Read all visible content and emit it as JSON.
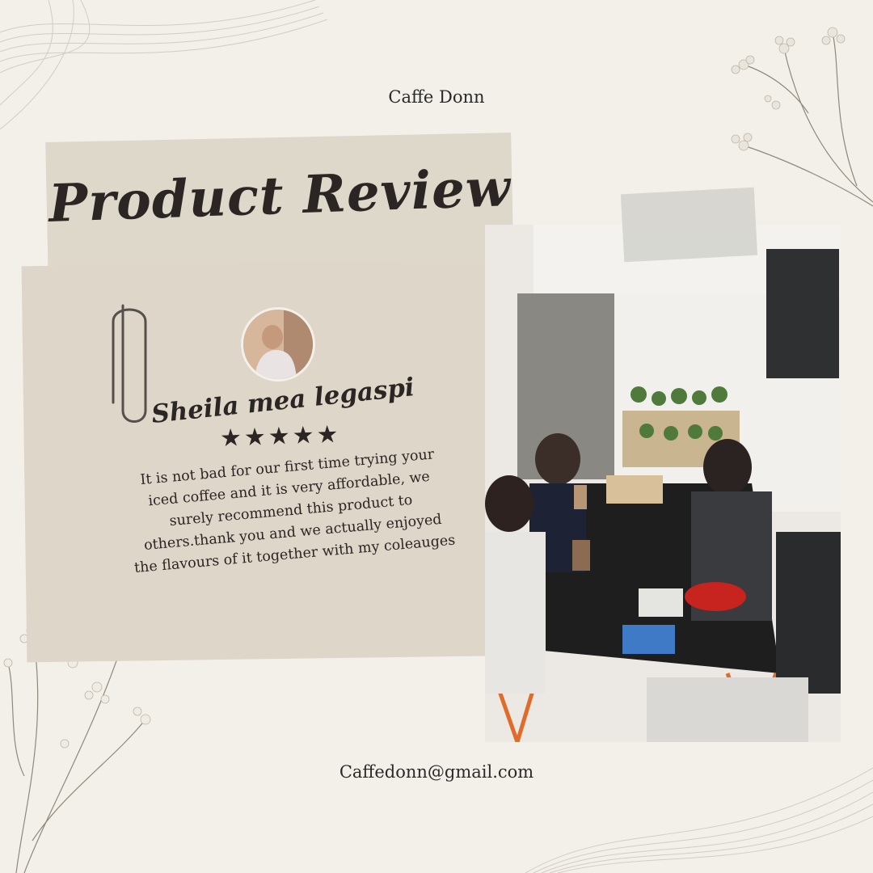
{
  "brand": "Caffe Donn",
  "title": "Product Review",
  "reviewer_name": "Sheila mea legaspi",
  "rating": 5,
  "stars": "★★★★★",
  "review_text": "It is not bad for our first time trying your iced coffee and it is very affordable, we surely recommend this product to others.thank you and we actually enjoyed the flavours of it together with my coleauges",
  "email": "Caffedonn@gmail.com",
  "colors": {
    "background": "#f3efe9",
    "paper": "#ddd6c9",
    "tape": "#ddd8c9",
    "ink": "#2b2523"
  },
  "icons": [
    "paperclip-icon",
    "star-icon",
    "dried-flower-decoration",
    "wave-line-decoration"
  ]
}
